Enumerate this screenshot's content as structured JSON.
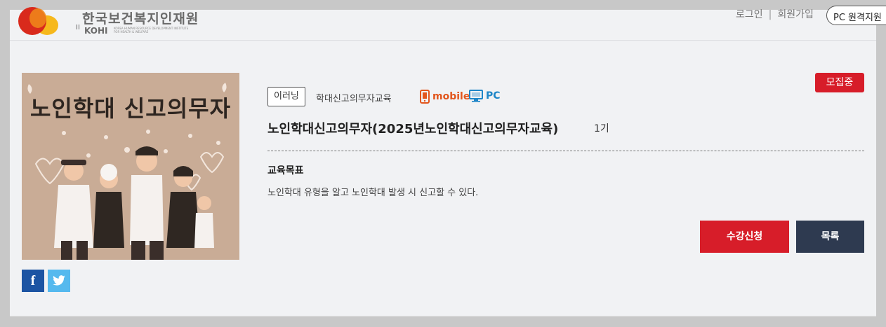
{
  "header": {
    "logo_name_kr": "한국보건복지인재원",
    "logo_abbr": "KOHI",
    "logo_sub_en_1": "KOREA HUMAN RESOURCE DEVELOPMENT INSTITUTE",
    "logo_sub_en_2": "FOR HEALTH & WELFARE",
    "login_label": "로그인",
    "signup_label": "회원가입",
    "pc_remote_label": "PC 원격지원"
  },
  "course": {
    "thumbnail_title": "노인학대 신고의무자",
    "status_badge": "모집중",
    "type_tag": "이러닝",
    "category": "학대신고의무자교육",
    "device_mobile": "mobile",
    "device_pc": "PC",
    "title": "노인학대신고의무자(2025년노인학대신고의무자교육)",
    "cohort": "1기",
    "goal_heading": "교육목표",
    "goal_text": "노인학대 유형을 알고 노인학대 발생 시 신고할 수 있다.",
    "apply_button": "수강신청",
    "list_button": "목록"
  },
  "share": {
    "facebook_glyph": "f"
  },
  "colors": {
    "accent_red": "#d71d29",
    "navy": "#2e3a50",
    "mobile_orange": "#e2561d",
    "pc_blue": "#1e86c8",
    "facebook": "#1c54a3",
    "twitter": "#55b9ee"
  }
}
